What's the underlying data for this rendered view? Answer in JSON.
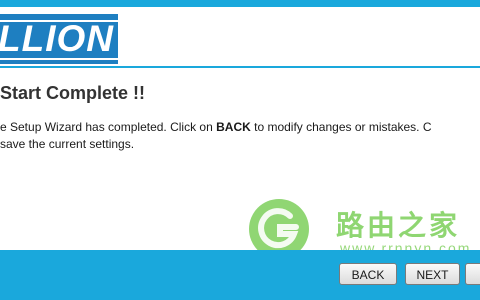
{
  "brand": {
    "logo_text": "LLION"
  },
  "page": {
    "title": "Start Complete !!",
    "message": {
      "line1_prefix": "e Setup Wizard has completed. Click on ",
      "back_keyword": "BACK",
      "line1_suffix": " to modify changes or mistakes. C",
      "line2": "save the current settings."
    }
  },
  "watermark": {
    "text": "路由之家",
    "url": "www.rrnnyn.com",
    "color": "#7ccf5a"
  },
  "footer": {
    "back_label": "BACK",
    "next_label": "NEXT"
  },
  "colors": {
    "accent": "#1aa8dc",
    "logo_blue": "#1e7fc1"
  }
}
